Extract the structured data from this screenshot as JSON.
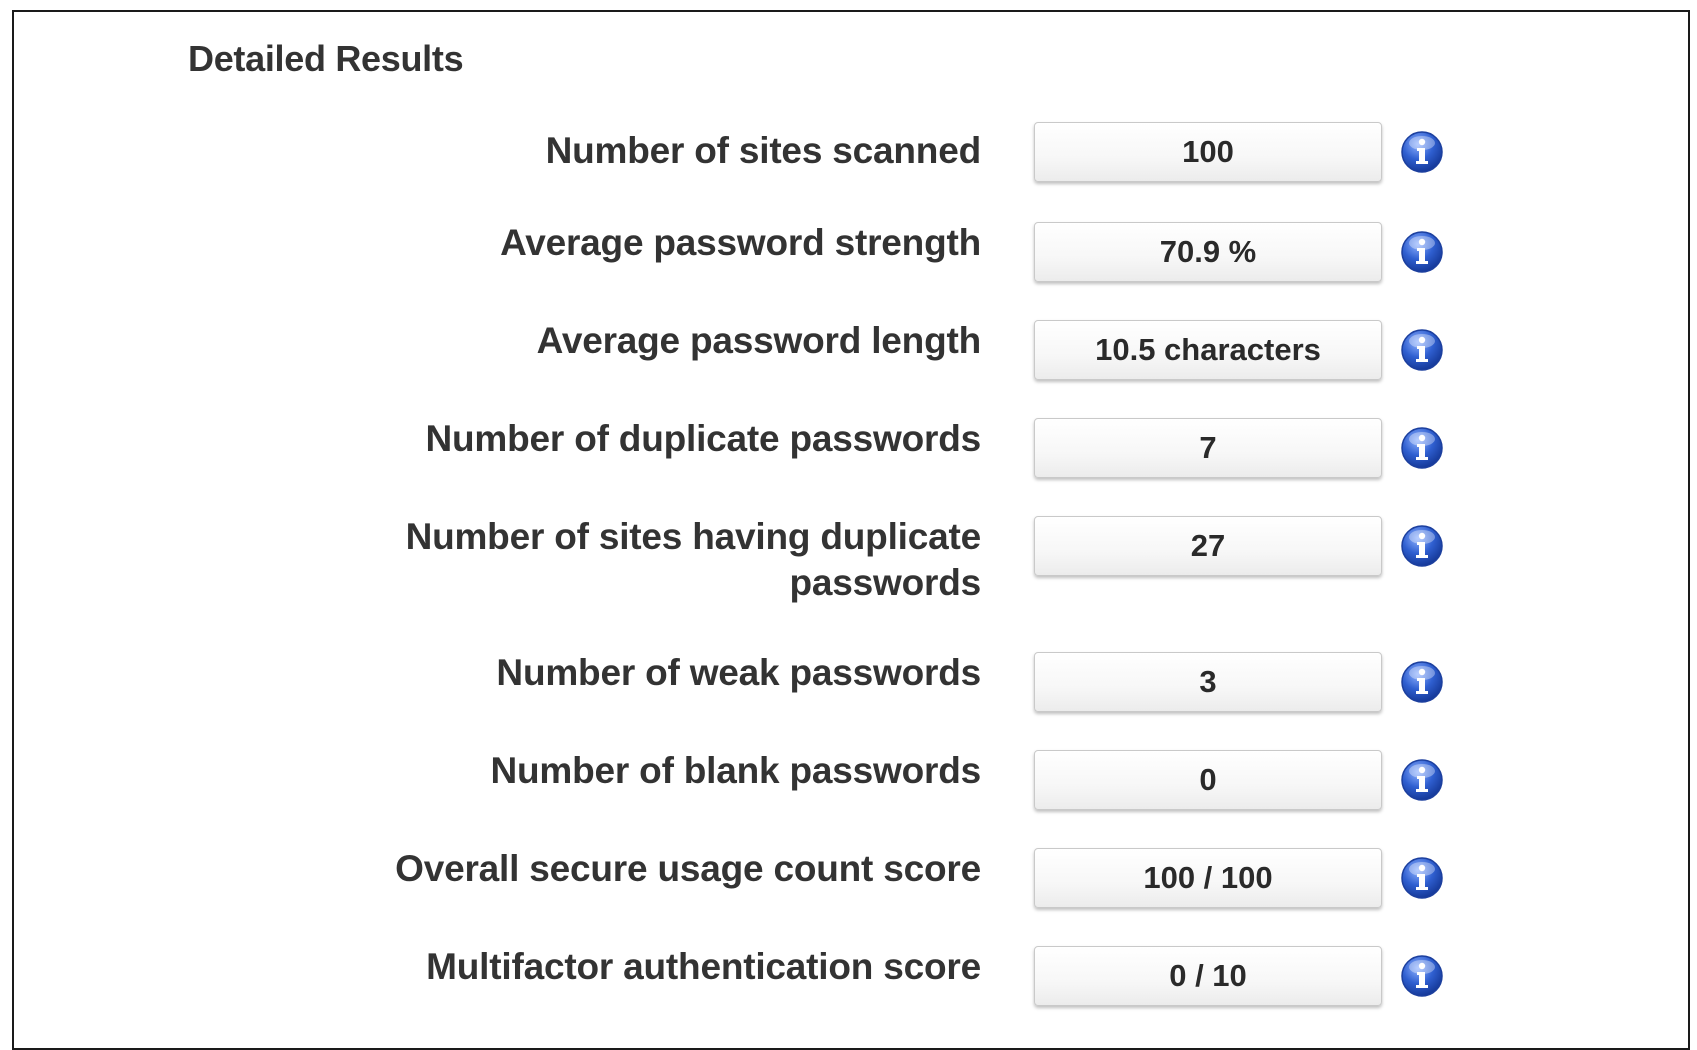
{
  "section": {
    "title": "Detailed Results"
  },
  "rows": [
    {
      "label": "Number of sites scanned",
      "value": "100",
      "icon": "info-icon"
    },
    {
      "label": "Average password strength",
      "value": "70.9 %",
      "icon": "info-icon"
    },
    {
      "label": "Average password length",
      "value": "10.5 characters",
      "icon": "info-icon"
    },
    {
      "label": "Number of duplicate passwords",
      "value": "7",
      "icon": "info-icon"
    },
    {
      "label": "Number of sites having duplicate passwords",
      "value": "27",
      "icon": "info-icon"
    },
    {
      "label": "Number of weak passwords",
      "value": "3",
      "icon": "info-icon"
    },
    {
      "label": "Number of blank passwords",
      "value": "0",
      "icon": "info-icon"
    },
    {
      "label": "Overall secure usage count score",
      "value": "100 / 100",
      "icon": "info-icon"
    },
    {
      "label": "Multifactor authentication score",
      "value": "0 / 10",
      "icon": "info-icon"
    }
  ],
  "colors": {
    "text": "#333333",
    "info_icon_blue": "#2f5fd0"
  }
}
